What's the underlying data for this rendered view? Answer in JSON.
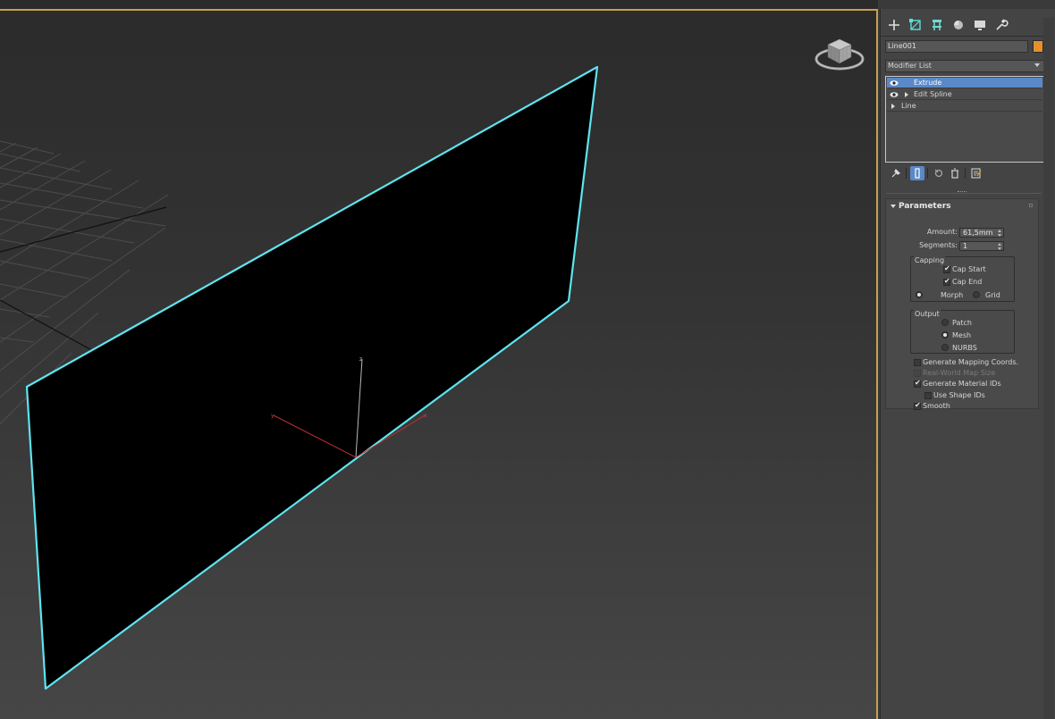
{
  "colors": {
    "selection_outline": "#5ee4ee",
    "viewport_border": "#c8a048",
    "object_color": "#e4902c",
    "highlight": "#5a88c8"
  },
  "viewport": {
    "gizmo_axes": {
      "x": "x",
      "y": "y",
      "z": "z"
    }
  },
  "command_panel": {
    "tabs": [
      {
        "icon": "create-plus-icon"
      },
      {
        "icon": "modify-icon"
      },
      {
        "icon": "hierarchy-icon"
      },
      {
        "icon": "motion-icon"
      },
      {
        "icon": "display-icon"
      },
      {
        "icon": "utilities-wrench-icon"
      }
    ],
    "object_name": "Line001",
    "modifier_list_label": "Modifier List",
    "stack": [
      {
        "label": "Extrude",
        "selected": true,
        "eye": true,
        "expand": false
      },
      {
        "label": "Edit Spline",
        "selected": false,
        "eye": true,
        "expand": true
      },
      {
        "label": "Line",
        "selected": false,
        "eye": false,
        "expand": true
      }
    ],
    "stack_tools": [
      "pin-stack-icon",
      "show-end-result-icon",
      "make-unique-icon",
      "remove-modifier-icon",
      "configure-modifier-sets-icon"
    ]
  },
  "parameters": {
    "title": "Parameters",
    "amount_label": "Amount:",
    "amount_value": "61,5mm",
    "segments_label": "Segments:",
    "segments_value": "1",
    "capping": {
      "title": "Capping",
      "cap_start": "Cap Start",
      "cap_end": "Cap End",
      "morph": "Morph",
      "grid": "Grid"
    },
    "output": {
      "title": "Output",
      "patch": "Patch",
      "mesh": "Mesh",
      "nurbs": "NURBS"
    },
    "gen_mapping": "Generate Mapping Coords.",
    "real_world": "Real-World Map Size",
    "gen_material_ids": "Generate Material IDs",
    "use_shape_ids": "Use Shape IDs",
    "smooth": "Smooth"
  }
}
